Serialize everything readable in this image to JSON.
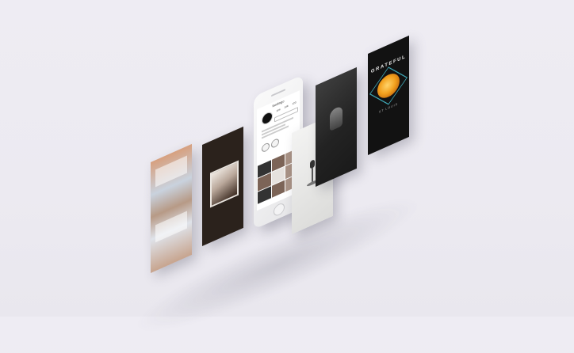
{
  "phone": {
    "handle": "fastlingo",
    "stats": [
      "104",
      "146",
      "123"
    ]
  },
  "cards": {
    "rose_title": "GRATEFUL",
    "rose_subtitle": "ST LOUIS"
  }
}
